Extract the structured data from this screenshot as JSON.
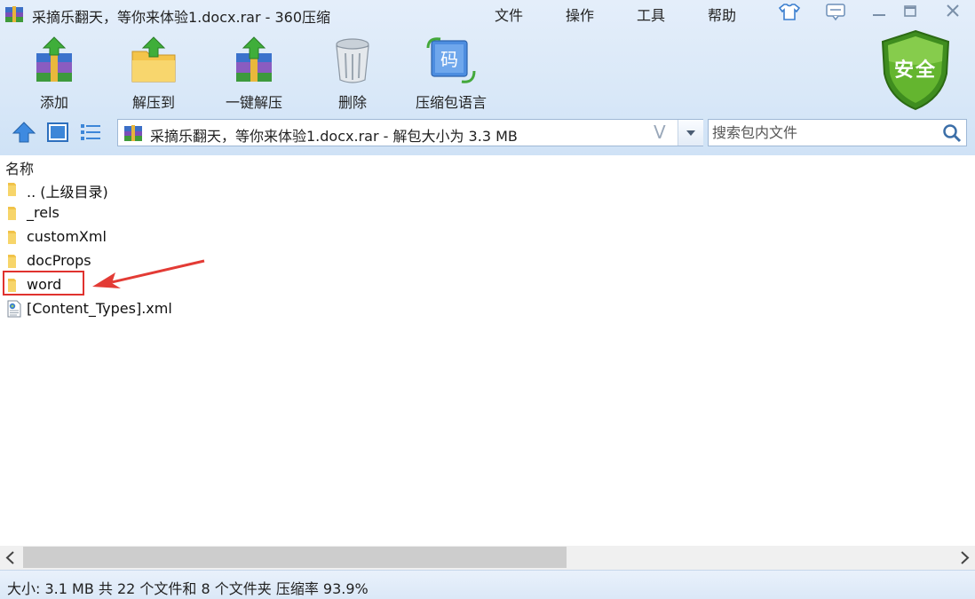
{
  "window": {
    "title": "采摘乐翻天，等你来体验1.docx.rar - 360压缩",
    "menu": [
      "文件",
      "操作",
      "工具",
      "帮助"
    ]
  },
  "toolbar": {
    "buttons": [
      {
        "label": "添加",
        "icon": "add-archive-icon"
      },
      {
        "label": "解压到",
        "icon": "extract-folder-icon"
      },
      {
        "label": "一键解压",
        "icon": "one-click-extract-icon"
      },
      {
        "label": "删除",
        "icon": "trash-icon"
      },
      {
        "label": "压缩包语言",
        "icon": "archive-language-icon"
      }
    ],
    "security_badge": "安全"
  },
  "address_bar": {
    "path": "采摘乐翻天，等你来体验1.docx.rar - 解包大小为 3.3 MB",
    "verify_glyph": "V"
  },
  "search": {
    "placeholder": "搜索包内文件"
  },
  "file_list": {
    "column_name": "名称",
    "items": [
      {
        "name": ".. (上级目录)",
        "type": "folder"
      },
      {
        "name": "_rels",
        "type": "folder"
      },
      {
        "name": "customXml",
        "type": "folder"
      },
      {
        "name": "docProps",
        "type": "folder"
      },
      {
        "name": "word",
        "type": "folder",
        "highlighted": true
      },
      {
        "name": "[Content_Types].xml",
        "type": "xml-file"
      }
    ]
  },
  "status": {
    "text": "大小: 3.1 MB 共 22 个文件和 8 个文件夹 压缩率 93.9%"
  },
  "colors": {
    "accent": "#2f7fd6",
    "highlight_box": "#e0322e",
    "shield_green": "#4c9a22"
  }
}
